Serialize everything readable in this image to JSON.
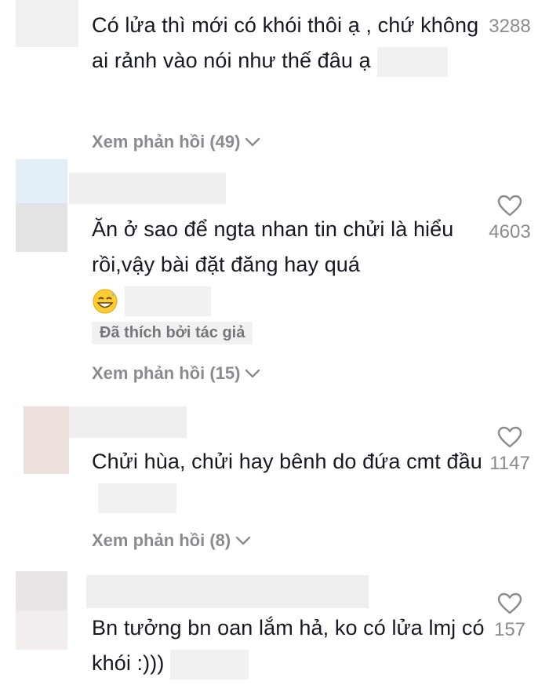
{
  "comments": [
    {
      "text": "Có lửa thì mới có khói thôi ạ , chứ không ai rảnh vào nói như thế đâu ạ",
      "likes": "3288",
      "replies": "Xem phản hồi (49)"
    },
    {
      "text": "Ăn ở sao để ngta nhan tin chửi là hiểu rồi,vậy bài đặt đăng hay quá",
      "emoji": "grinning-sweat-emoji",
      "likes": "4603",
      "badge": "Đã thích bởi tác giả",
      "replies": "Xem phản hồi (15)"
    },
    {
      "text": "Chửi hùa, chửi hay bênh do đứa cmt đầu",
      "likes": "1147",
      "replies": "Xem phản hồi (8)"
    },
    {
      "text": "Bn tưởng bn oan lắm hả, ko có lửa lmj có khói :)))",
      "likes": "157"
    }
  ],
  "icons": {
    "like": "heart-outline-icon",
    "expand": "chevron-down-icon"
  },
  "colors": {
    "text": "#161823",
    "secondary": "#8a8b91",
    "badge_bg": "#f1f1f2"
  }
}
